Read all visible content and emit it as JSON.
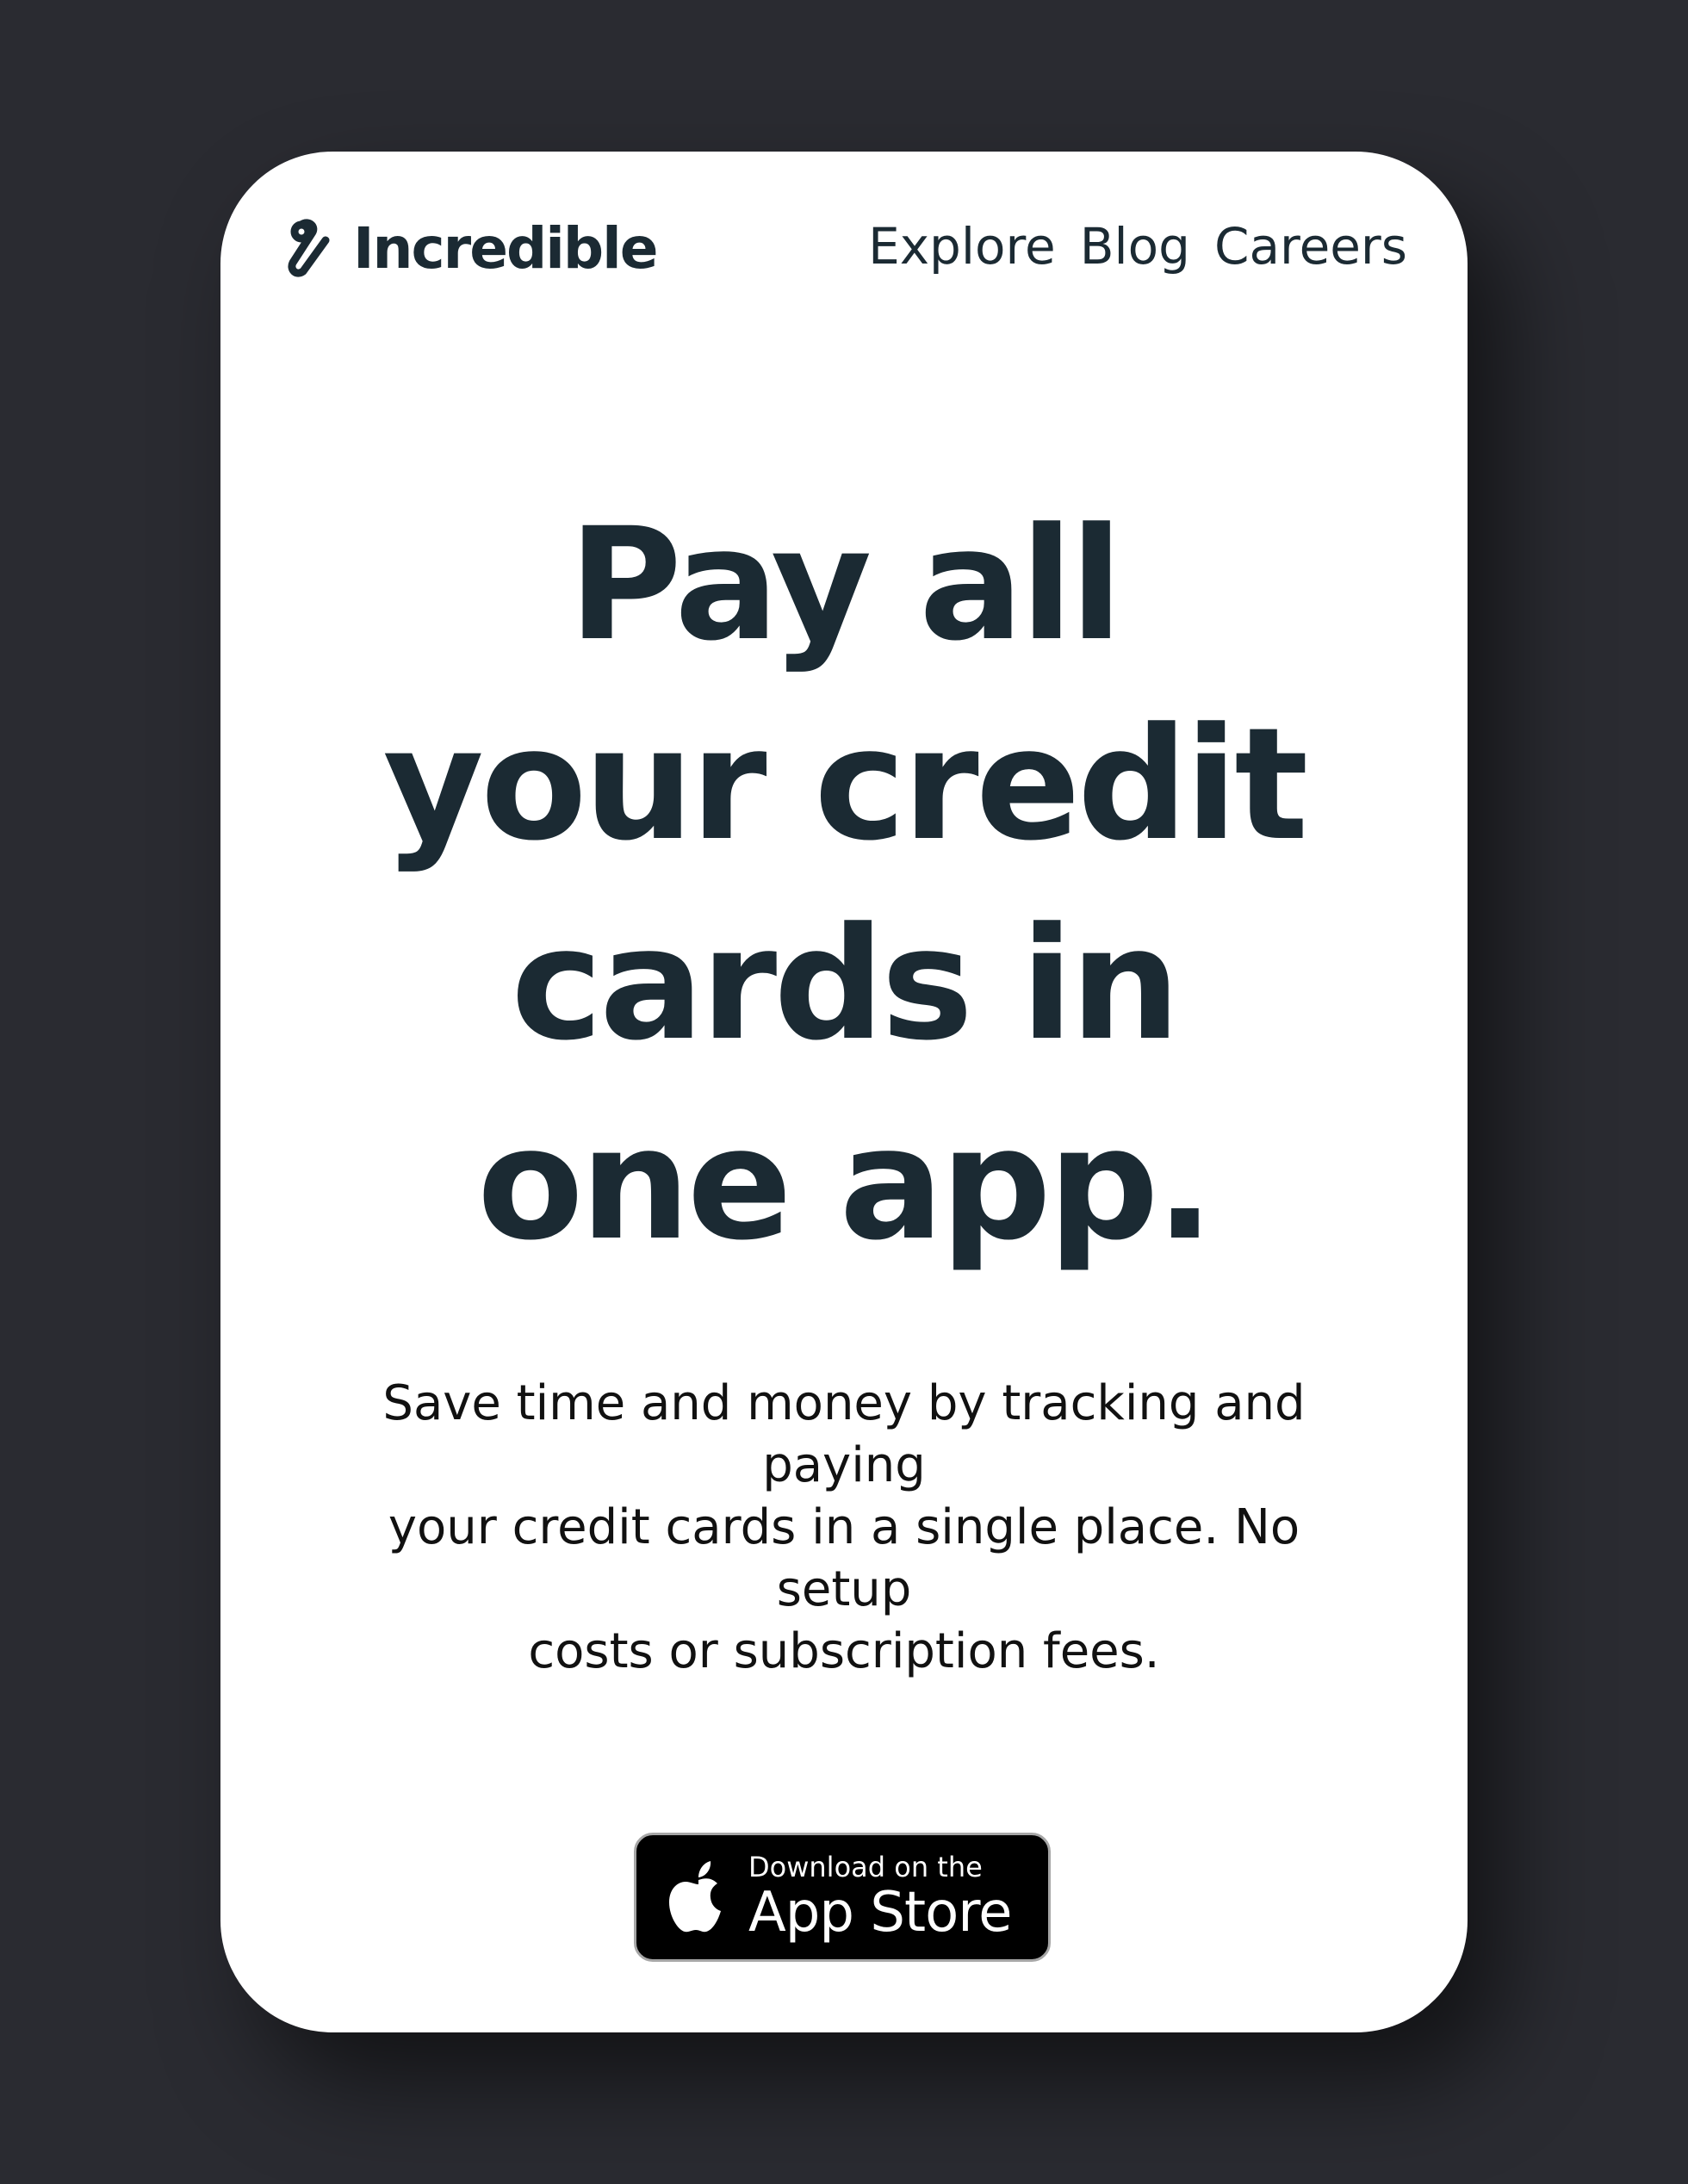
{
  "header": {
    "logo_text": "Incredible",
    "nav": [
      "Explore",
      "Blog",
      "Careers"
    ]
  },
  "hero": {
    "title_lines": [
      "Pay all",
      "your credit",
      "cards in",
      "one app."
    ],
    "subtitle_lines": [
      "Save time and money by tracking and",
      "paying",
      "your credit cards in a single place. No",
      "setup",
      "costs or subscription fees."
    ]
  },
  "app_store": {
    "small_label": "Download on the",
    "big_label": "App Store",
    "icon": "apple-icon"
  },
  "colors": {
    "background": "#2a2b31",
    "card": "#ffffff",
    "text": "#1b2a33",
    "badge": "#000000"
  }
}
